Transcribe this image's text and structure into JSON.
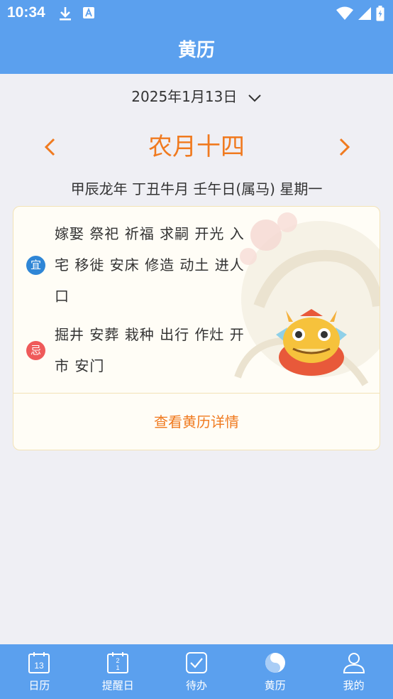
{
  "status_bar": {
    "time": "10:34"
  },
  "header": {
    "title": "黄历"
  },
  "date_picker": {
    "label": "2025年1月13日"
  },
  "lunar": {
    "date": "农月十四"
  },
  "ganzhi": "甲辰龙年 丁丑牛月 壬午日(属马) 星期一",
  "almanac": {
    "yi_badge": "宜",
    "yi_lines": [
      "嫁娶 祭祀 祈福 求嗣 开光 入",
      "宅 移徙 安床 修造 动土 进人",
      "口"
    ],
    "ji_badge": "忌",
    "ji_lines": [
      "掘井 安葬 栽种 出行 作灶 开",
      "市 安门"
    ],
    "details_label": "查看黄历详情"
  },
  "tabs": [
    {
      "label": "日历",
      "icon": "calendar-icon",
      "icon_text": "13"
    },
    {
      "label": "提醒日",
      "icon": "reminder-calendar-icon",
      "icon_text": "2\n1"
    },
    {
      "label": "待办",
      "icon": "checkbox-icon"
    },
    {
      "label": "黄历",
      "icon": "yin-yang-icon"
    },
    {
      "label": "我的",
      "icon": "user-icon"
    }
  ],
  "colors": {
    "primary": "#5ba0ee",
    "accent": "#f07a1f",
    "yi": "#2f86d6",
    "ji": "#ef5a5a"
  }
}
